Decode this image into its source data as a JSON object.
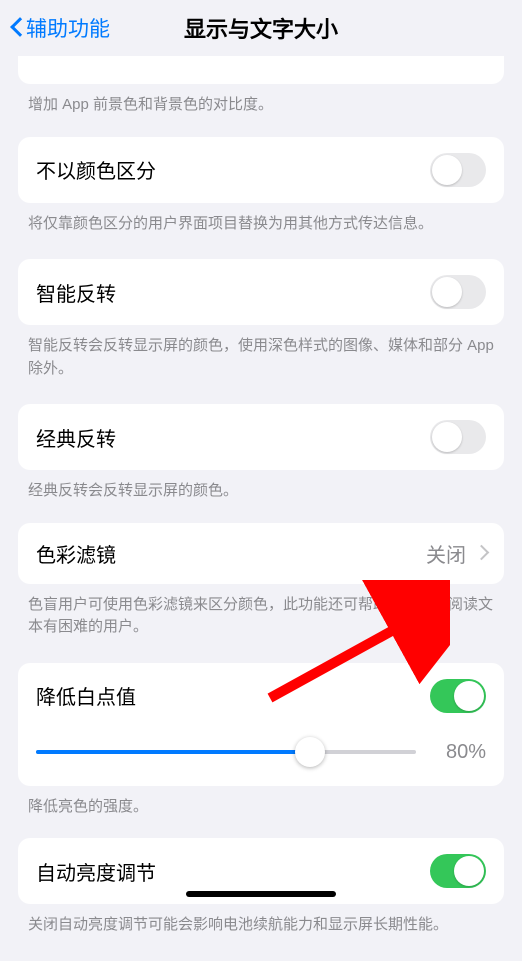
{
  "nav": {
    "back_label": "辅助功能",
    "title": "显示与文字大小"
  },
  "sections": {
    "contrast_hint": "增加 App 前景色和背景色的对比度。",
    "differentiate": {
      "label": "不以颜色区分",
      "on": false,
      "hint": "将仅靠颜色区分的用户界面项目替换为用其他方式传达信息。"
    },
    "smart_invert": {
      "label": "智能反转",
      "on": false,
      "hint": "智能反转会反转显示屏的颜色，使用深色样式的图像、媒体和部分 App 除外。"
    },
    "classic_invert": {
      "label": "经典反转",
      "on": false,
      "hint": "经典反转会反转显示屏的颜色。"
    },
    "color_filters": {
      "label": "色彩滤镜",
      "value": "关闭",
      "hint": "色盲用户可使用色彩滤镜来区分颜色，此功能还可帮助在屏幕上阅读文本有困难的用户。"
    },
    "reduce_white": {
      "label": "降低白点值",
      "on": true,
      "percent_label": "80%",
      "hint": "降低亮色的强度。"
    },
    "auto_brightness": {
      "label": "自动亮度调节",
      "on": true,
      "hint": "关闭自动亮度调节可能会影响电池续航能力和显示屏长期性能。"
    }
  }
}
